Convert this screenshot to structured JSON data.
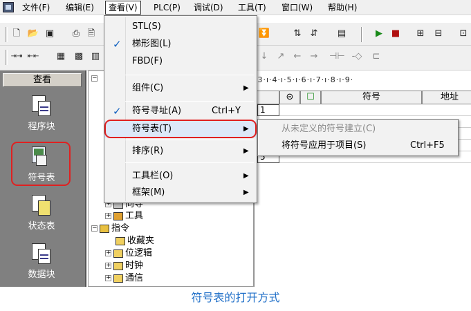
{
  "menubar": {
    "items": [
      "文件(F)",
      "编辑(E)",
      "查看(V)",
      "PLC(P)",
      "调试(D)",
      "工具(T)",
      "窗口(W)",
      "帮助(H)"
    ],
    "active": "查看(V)"
  },
  "navpane": {
    "title": "查看",
    "items": [
      "程序块",
      "符号表",
      "状态表",
      "数据块"
    ],
    "highlighted": "符号表"
  },
  "tree": {
    "rows": [
      "向导",
      "工具",
      "指令",
      "收藏夹",
      "位逻辑",
      "时钟",
      "通信"
    ]
  },
  "grid": {
    "ruler": "·3·ı·4·ı·5·ı·6·ı·7·ı·8·ı·9·",
    "headers": [
      "符号",
      "地址"
    ],
    "row_numbers": [
      "1",
      "5"
    ]
  },
  "view_menu": {
    "items": [
      {
        "label": "STL(S)",
        "checked": false,
        "shortcut": "",
        "submenu": false
      },
      {
        "label": "梯形图(L)",
        "checked": true,
        "shortcut": "",
        "submenu": false
      },
      {
        "label": "FBD(F)",
        "checked": false,
        "shortcut": "",
        "submenu": false
      },
      {
        "label": "组件(C)",
        "checked": false,
        "shortcut": "",
        "submenu": true
      },
      {
        "label": "符号寻址(A)",
        "checked": true,
        "shortcut": "Ctrl+Y",
        "submenu": false
      },
      {
        "label": "符号表(T)",
        "checked": false,
        "shortcut": "",
        "submenu": true
      },
      {
        "label": "排序(R)",
        "checked": false,
        "shortcut": "",
        "submenu": true
      },
      {
        "label": "工具栏(O)",
        "checked": false,
        "shortcut": "",
        "submenu": true
      },
      {
        "label": "框架(M)",
        "checked": false,
        "shortcut": "",
        "submenu": true
      }
    ]
  },
  "symbol_submenu": {
    "items": [
      {
        "label": "从未定义的符号建立(C)",
        "shortcut": "",
        "disabled": true
      },
      {
        "label": "将符号应用于项目(S)",
        "shortcut": "Ctrl+F5",
        "disabled": false
      }
    ]
  },
  "caption": "符号表的打开方式",
  "colors": {
    "highlight": "#e02020",
    "caption": "#1f6fc8",
    "nav_bg": "#808080"
  }
}
